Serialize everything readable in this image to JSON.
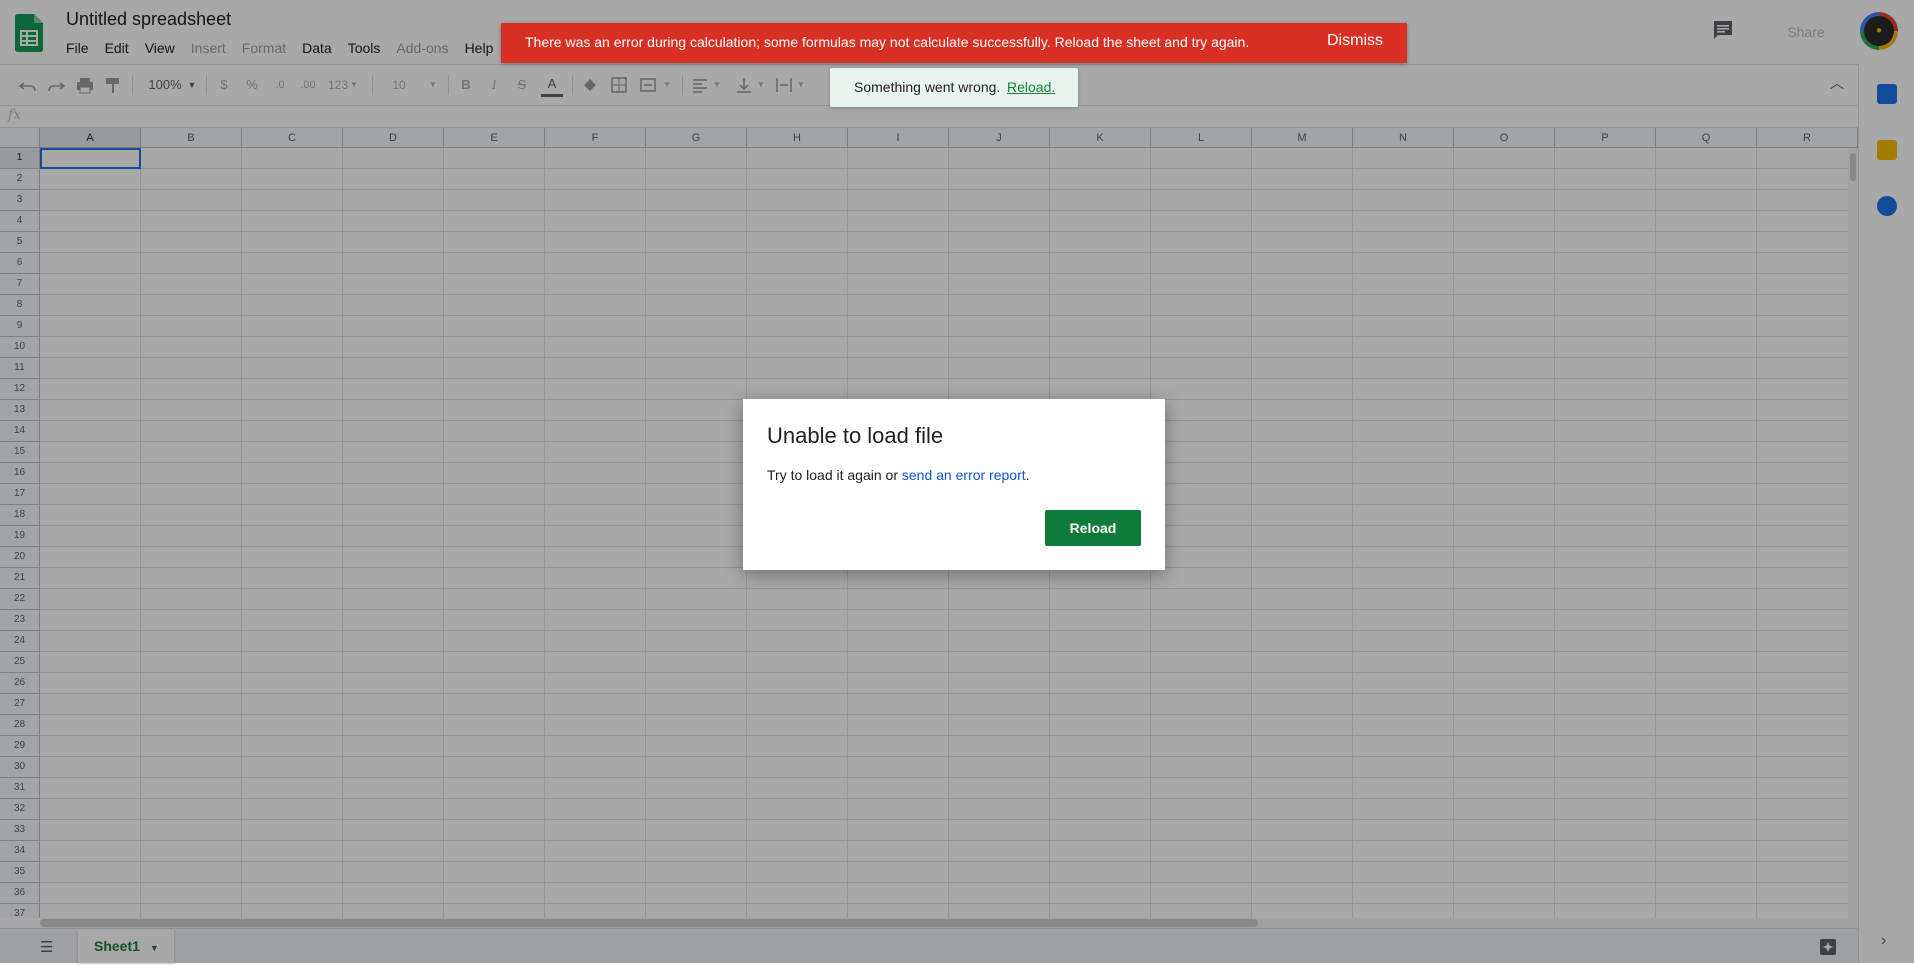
{
  "document": {
    "title": "Untitled spreadsheet"
  },
  "menu": [
    {
      "label": "File",
      "enabled": true
    },
    {
      "label": "Edit",
      "enabled": true
    },
    {
      "label": "View",
      "enabled": true
    },
    {
      "label": "Insert",
      "enabled": false
    },
    {
      "label": "Format",
      "enabled": false
    },
    {
      "label": "Data",
      "enabled": true
    },
    {
      "label": "Tools",
      "enabled": true
    },
    {
      "label": "Add-ons",
      "enabled": false
    },
    {
      "label": "Help",
      "enabled": true
    }
  ],
  "header": {
    "share_label": "Share"
  },
  "toolbar": {
    "zoom": "100%",
    "currency": "$",
    "percent": "%",
    "decrease_decimals": ".0",
    "increase_decimals": ".00",
    "more_formats": "123",
    "font_size": "10",
    "bold": "B",
    "italic": "I",
    "strikethrough": "S",
    "text_color": "A"
  },
  "formula_bar": {
    "fx_label": "fx"
  },
  "grid": {
    "columns": [
      "A",
      "B",
      "C",
      "D",
      "E",
      "F",
      "G",
      "H",
      "I",
      "J",
      "K",
      "L",
      "M",
      "N",
      "O",
      "P",
      "Q",
      "R"
    ],
    "rows": [
      "1",
      "2",
      "3",
      "4",
      "5",
      "6",
      "7",
      "8",
      "9",
      "10",
      "11",
      "12",
      "13",
      "14",
      "15",
      "16",
      "17",
      "18",
      "19",
      "20",
      "21",
      "22",
      "23",
      "24",
      "25",
      "26",
      "27",
      "28",
      "29",
      "30",
      "31",
      "32",
      "33",
      "34",
      "35",
      "36",
      "37"
    ],
    "selected_cell": "A1"
  },
  "sheets": [
    {
      "name": "Sheet1",
      "active": true
    }
  ],
  "error_banner": {
    "message": "There was an error during calculation; some formulas may not calculate successfully. Reload the sheet and try again.",
    "dismiss_label": "Dismiss"
  },
  "toast": {
    "message": "Something went wrong.",
    "link_label": "Reload."
  },
  "dialog": {
    "title": "Unable to load file",
    "body_prefix": "Try to load it again or ",
    "link_label": "send an error report",
    "body_suffix": ".",
    "button_label": "Reload"
  },
  "colors": {
    "sheets_green": "#0f9d58",
    "error_red": "#d93025",
    "toast_bg": "#e8f5ee",
    "reload_button": "#0f7b3b",
    "link_blue": "#1155cc",
    "selection_blue": "#1a73e8"
  },
  "icons": {
    "undo": "undo-icon",
    "redo": "redo-icon",
    "print": "print-icon",
    "paint_format": "paint-format-icon",
    "fill": "fill-color-icon",
    "borders": "borders-icon",
    "merge": "merge-cells-icon",
    "align_h": "horizontal-align-icon",
    "align_v": "vertical-align-icon",
    "wrap": "text-wrap-icon",
    "comments": "comment-history-icon",
    "explore": "explore-icon"
  }
}
